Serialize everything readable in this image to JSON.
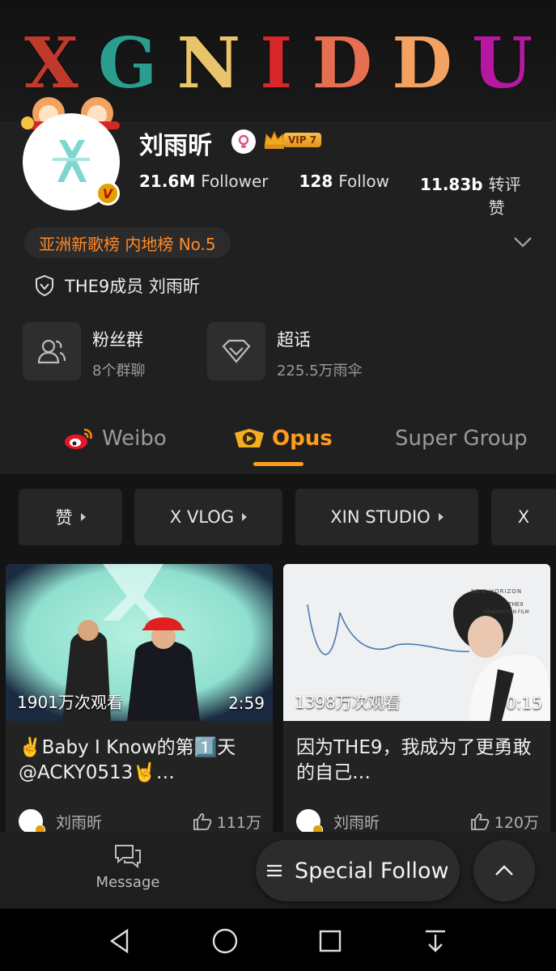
{
  "banner": {
    "letters": [
      "X",
      "G",
      "N",
      "I",
      "D",
      "D",
      "U"
    ]
  },
  "profile": {
    "name": "刘雨昕",
    "vip_label": "VIP 7",
    "verified_mark": "V",
    "stats": [
      {
        "value": "21.6M",
        "label": "Follower"
      },
      {
        "value": "128",
        "label": "Follow"
      },
      {
        "value": "11.83b",
        "label": "转评赞"
      }
    ],
    "rank_text": "亚洲新歌榜 内地榜 No.5",
    "member_text": "THE9成员 刘雨昕"
  },
  "cards": [
    {
      "title": "粉丝群",
      "subtitle": "8个群聊",
      "icon": "people-icon"
    },
    {
      "title": "超话",
      "subtitle": "225.5万雨伞",
      "icon": "diamond-icon"
    }
  ],
  "tabs": [
    {
      "label": "Weibo",
      "icon": "weibo-icon",
      "active": false
    },
    {
      "label": "Opus",
      "icon": "opus-icon",
      "active": true
    },
    {
      "label": "Super Group",
      "active": false
    }
  ],
  "chips": [
    "赞",
    "X VLOG",
    "XIN STUDIO",
    "X"
  ],
  "videos": [
    {
      "views": "1901万次观看",
      "duration": "2:59",
      "title": "✌️Baby I Know的第1️⃣天@ACKY0513🤘…",
      "author": "刘雨昕",
      "likes": "111万"
    },
    {
      "views": "1398万次观看",
      "duration": "0:15",
      "title": "因为THE9，我成为了更勇敢的自己…",
      "author": "刘雨昕",
      "likes": "120万",
      "overlay_text": [
        "NEW HORIZON",
        "THE9",
        "GRADUATION FILM"
      ]
    }
  ],
  "bottom": {
    "message_label": "Message",
    "special_follow_label": "Special Follow"
  },
  "colors": {
    "accent": "#ff9c1e",
    "rank": "#ff8a2a",
    "background": "#1c1c1c"
  }
}
